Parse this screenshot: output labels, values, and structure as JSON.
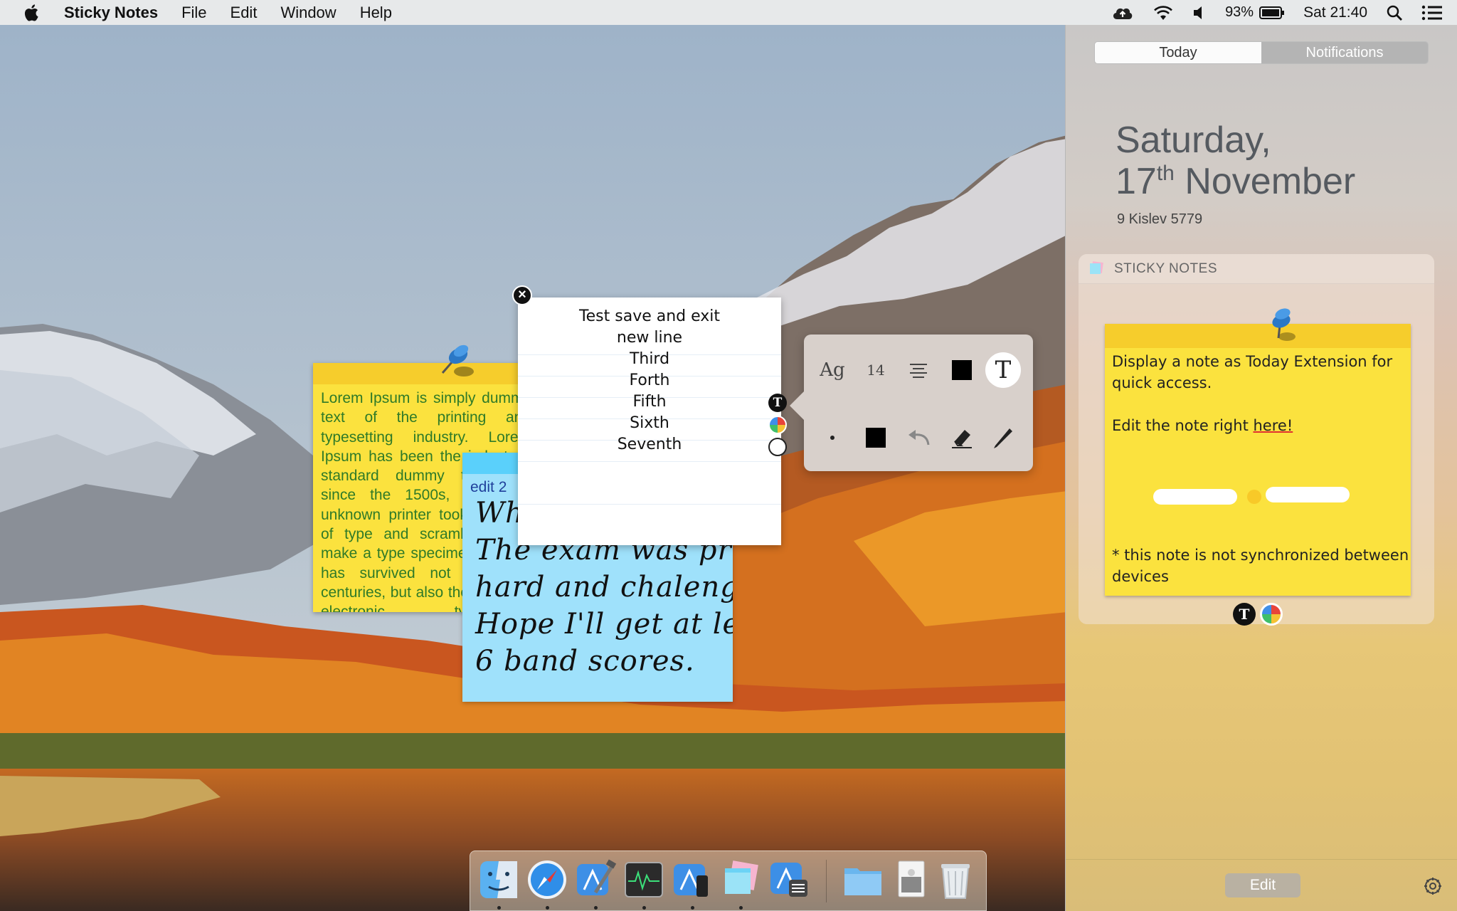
{
  "menubar": {
    "app_name": "Sticky Notes",
    "menus": [
      "File",
      "Edit",
      "Window",
      "Help"
    ],
    "battery": "93%",
    "clock": "Sat 21:40"
  },
  "notification_center": {
    "tabs": [
      "Today",
      "Notifications"
    ],
    "day": "Saturday,",
    "date_num": "17",
    "date_suffix": "th",
    "month": " November",
    "hebrew_date": "9 Kislev 5779",
    "widget_title": "STICKY NOTES",
    "note_line1": "Display a note as Today Extension for",
    "note_line2": "quick access.",
    "note_edit_prefix": "Edit the note right ",
    "note_edit_link": "here!",
    "note_footer1": "* this note is not synchronized between",
    "note_footer2": "devices",
    "edit_button": "Edit"
  },
  "yellow_note": {
    "text": "Lorem Ipsum is simply dummy text of the printing and typesetting industry. Lorem Ipsum has been the industry's standard dummy text ever since the 1500s, when an unknown printer took a galley of type and scrambled it to make a type specimen book. It has survived not only five centuries, but also the leap into electronic typesetting, remaining essentially unchanged."
  },
  "blue_note": {
    "label": "edit 2",
    "lines": [
      "What",
      "The exam was pretty",
      "hard and chalenging.",
      "Hope I'll get at least",
      "6 band scores."
    ]
  },
  "white_note": {
    "lines": [
      "Test save and exit",
      "new line",
      "Third",
      "Forth",
      "Fifth",
      "Sixth",
      "Seventh"
    ],
    "close_glyph": "×",
    "text_icon": "T"
  },
  "popover": {
    "font_label": "Ag",
    "font_size": "14",
    "text_tool": "T"
  },
  "colors": {
    "yellow_note": "#fbe23e",
    "blue_note": "#9fe1fb",
    "yellow_text": "#2f7a28",
    "accent_red": "#e03030"
  },
  "icons": {
    "menubar": [
      "apple-icon",
      "cloud-upload-icon",
      "wifi-icon",
      "volume-icon",
      "battery-icon",
      "search-icon",
      "notification-center-icon"
    ],
    "popover": [
      "font-icon",
      "font-size-icon",
      "align-center-icon",
      "text-color-icon",
      "text-tool-icon",
      "pen-size-icon",
      "pen-color-icon",
      "undo-icon",
      "eraser-icon",
      "pencil-icon"
    ],
    "dock": [
      "finder-icon",
      "safari-icon",
      "xcode-icon",
      "activity-monitor-icon",
      "simulator-icon",
      "sticky-notes-icon",
      "app-store-connect-icon",
      "downloads-folder-icon",
      "preview-icon",
      "trash-icon"
    ]
  }
}
